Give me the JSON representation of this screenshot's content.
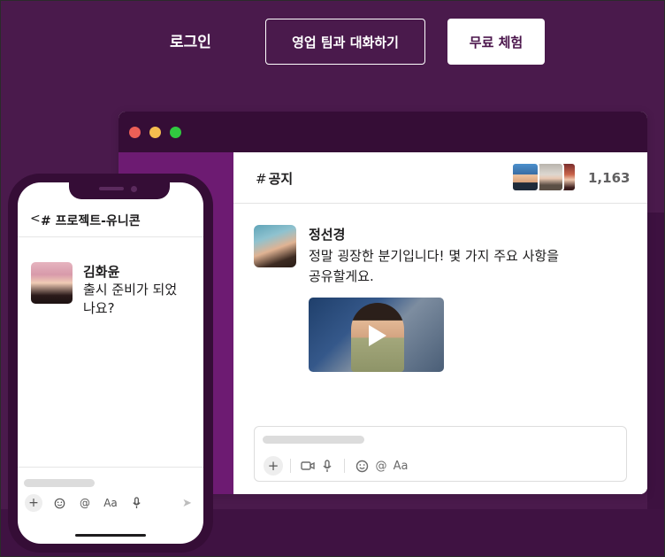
{
  "nav": {
    "login_label": "로그인",
    "sales_label": "영업 팀과 대화하기",
    "trial_label": "무료 체험"
  },
  "desktop": {
    "channel_hash": "#",
    "channel_name": "공지",
    "member_count": "1,163",
    "message": {
      "author": "정선경",
      "text": "정말 굉장한 분기입니다! 몇 가지 주요 사항을 공유할게요."
    },
    "composer_tools": {
      "video": "▭",
      "mic": "🎙",
      "emoji": "☺",
      "mention": "@",
      "format": "Aa"
    }
  },
  "phone": {
    "back": "<",
    "channel": "# 프로젝트-유니콘",
    "message": {
      "author": "김화윤",
      "text": "출시 준비가 되었나요?"
    },
    "tools": {
      "plus": "+",
      "emoji": "☺",
      "mention": "@",
      "format": "Aa",
      "mic": "🎙",
      "send": "➤"
    }
  },
  "colors": {
    "background": "#4a1a4c",
    "titlebar": "#350d36",
    "sidebar": "#6d1b72",
    "trial_text": "#4a154b",
    "dot_red": "#ec5f57",
    "dot_yellow": "#f4bd4f",
    "dot_green": "#31c840"
  }
}
